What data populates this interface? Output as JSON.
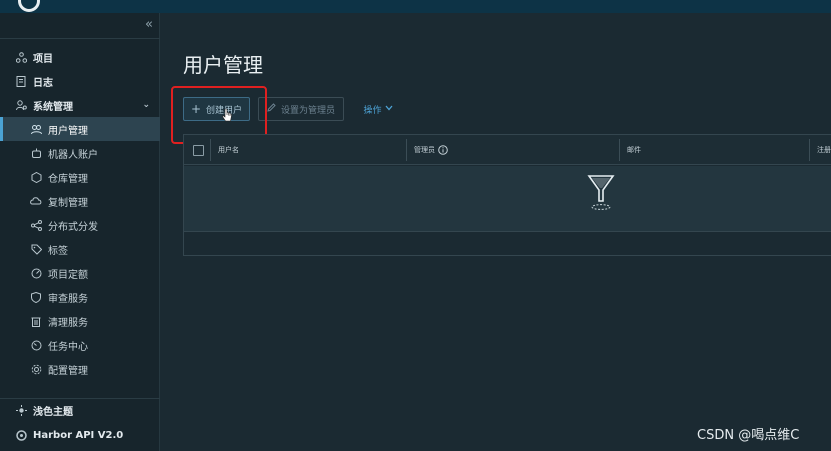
{
  "sidebar": {
    "collapse_glyph": "«",
    "top_items": [
      {
        "label": "项目",
        "icon": "project-icon"
      },
      {
        "label": "日志",
        "icon": "log-icon"
      },
      {
        "label": "系统管理",
        "icon": "system-admin-icon"
      }
    ],
    "sub_items": [
      {
        "label": "用户管理",
        "icon": "users-icon",
        "active": true
      },
      {
        "label": "机器人账户",
        "icon": "robot-icon"
      },
      {
        "label": "仓库管理",
        "icon": "registry-icon"
      },
      {
        "label": "复制管理",
        "icon": "replication-icon"
      },
      {
        "label": "分布式分发",
        "icon": "distribution-icon"
      },
      {
        "label": "标签",
        "icon": "tag-icon"
      },
      {
        "label": "项目定额",
        "icon": "quota-icon"
      },
      {
        "label": "审查服务",
        "icon": "shield-icon"
      },
      {
        "label": "清理服务",
        "icon": "trash-icon"
      },
      {
        "label": "任务中心",
        "icon": "gauge-icon"
      },
      {
        "label": "配置管理",
        "icon": "gear-icon"
      }
    ],
    "bottom_items": [
      {
        "label": "浅色主题",
        "icon": "sun-icon"
      },
      {
        "label": "Harbor API V2.0",
        "icon": "api-icon"
      }
    ]
  },
  "main": {
    "title": "用户管理",
    "toolbar": {
      "create_label": "创建用户",
      "set_admin_label": "设置为管理员",
      "ops_label": "操作"
    },
    "table": {
      "columns": [
        "用户名",
        "管理员",
        "邮件",
        "注册"
      ]
    }
  },
  "watermark": "CSDN @喝点维C",
  "colors": {
    "accent": "#4da3d6",
    "highlight": "#e02020",
    "active_bg": "#2d4450"
  }
}
